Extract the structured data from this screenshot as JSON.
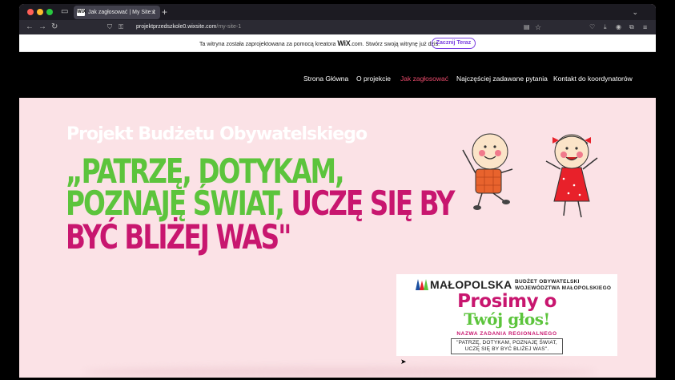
{
  "browser": {
    "tab_title": "Jak zagłosować | My Site 1",
    "tab_favicon": "WIX",
    "url_host": "projektprzedszkole0.wixsite.com",
    "url_path": "/my-site-1"
  },
  "wix_banner": {
    "text_before": "Ta witryna została zaprojektowana za pomocą kreatora",
    "brand": "WiX",
    "text_after": ".com. Stwórz swoją witrynę już dziś.",
    "button": "Zacznij Teraz"
  },
  "menu": {
    "items": [
      {
        "label": "Strona Główna"
      },
      {
        "label": "O projekcie"
      },
      {
        "label": "Jak zagłosować"
      },
      {
        "label": "Najczęściej zadawane pytania"
      },
      {
        "label": "Kontakt do koordynatorów"
      }
    ],
    "active_index": 2
  },
  "hero": {
    "subtitle": "Projekt Budżetu Obywatelskiego",
    "line1": "„PATRZĘ, DOTYKAM,",
    "line2_green": "POZNAJĘ ŚWIAT, ",
    "line2_pink": "UCZĘ SIĘ BY",
    "line3": "BYĆ BLIŻEJ WAS\""
  },
  "card": {
    "brand": "MAŁOPOLSKA",
    "budget_line1": "BUDŻET OBYWATELSKI",
    "budget_line2": "WOJEWÓDZTWA MAŁOPOLSKIEGO",
    "prosimy": "Prosimy o",
    "glos": "Twój głos!",
    "nazwa": "NAZWA ZADANIA REGIONALNEGO",
    "quote_line1": "\"PATRZĘ, DOTYKAM, POZNAJĘ ŚWIAT,",
    "quote_line2": "UCZĘ SIĘ BY BYĆ BLIŻEJ WAS\"."
  },
  "colors": {
    "green": "#5cc43c",
    "pink": "#c8166f",
    "page_bg": "#fbe2e6",
    "header_bg": "#000000",
    "menu_active": "#e84a6b"
  }
}
